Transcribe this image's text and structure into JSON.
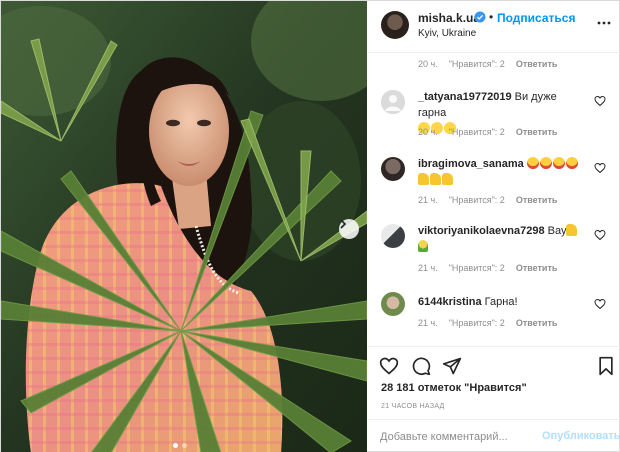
{
  "header": {
    "username": "misha.k.ua",
    "separator": "•",
    "follow_label": "Подписаться",
    "location": "Kyiv, Ukraine"
  },
  "comments": [
    {
      "username": "",
      "text": "",
      "time": "20 ч.",
      "likes": "\"Нравится\": 2",
      "reply": "Ответить"
    },
    {
      "username": "_tatyana19772019",
      "text": "Ви дуже гарна",
      "emoji": [
        "smile",
        "smile",
        "smile"
      ],
      "time": "20 ч.",
      "likes": "\"Нравится\": 2",
      "reply": "Ответить"
    },
    {
      "username": "ibragimova_sanama",
      "text": "",
      "emoji": [
        "heart-eyes",
        "heart-eyes",
        "heart-eyes",
        "heart-eyes",
        "thumb",
        "thumb",
        "thumb"
      ],
      "time": "21 ч.",
      "likes": "\"Нравится\": 2",
      "reply": "Ответить"
    },
    {
      "username": "viktoriyanikolaevna7298",
      "text": "Вау",
      "emoji": [
        "thumb",
        "bouquet"
      ],
      "time": "21 ч.",
      "likes": "\"Нравится\": 2",
      "reply": "Ответить"
    },
    {
      "username": "6144kristina",
      "text": "Гарна!",
      "time": "21 ч.",
      "likes": "\"Нравится\": 2",
      "reply": "Ответить"
    }
  ],
  "post": {
    "likes_count": "28 181 отметок \"Нравится\"",
    "time_ago": "21 ЧАСОВ НАЗАД"
  },
  "comment_box": {
    "placeholder": "Добавьте комментарий...",
    "publish_label": "Опубликовать"
  },
  "carousel": {
    "current": 1,
    "total": 2
  },
  "colors": {
    "accent": "#0095f6",
    "publish_disabled": "#b2dffc",
    "secondary_text": "#8e8e8e",
    "border": "#dbdbdb"
  },
  "icons": [
    "verified-badge-icon",
    "more-options-icon",
    "heart-icon",
    "comment-icon",
    "share-icon",
    "bookmark-icon",
    "chevron-right-icon"
  ]
}
